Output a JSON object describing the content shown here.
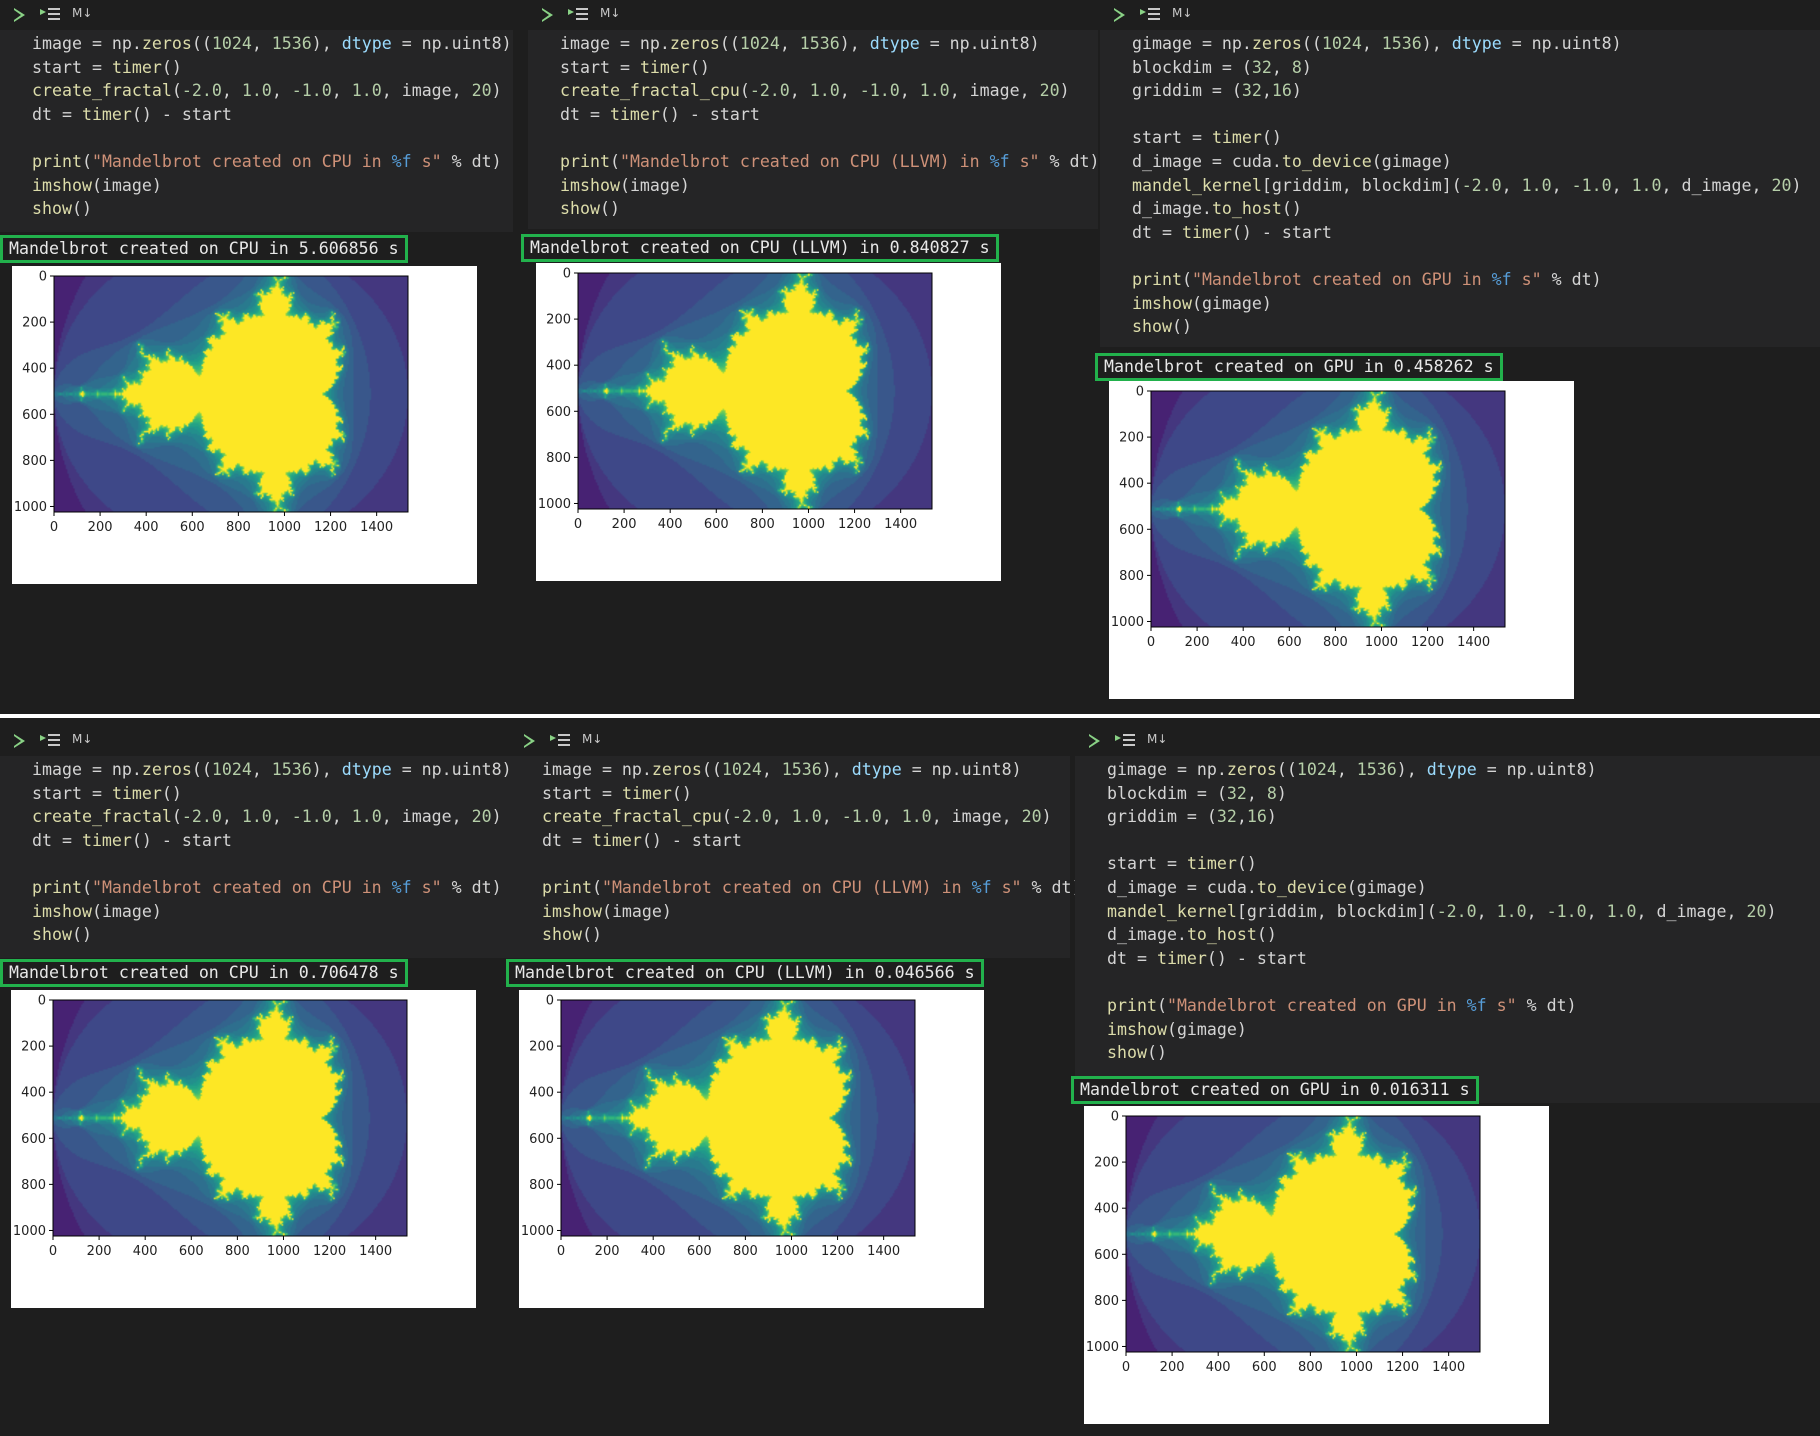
{
  "toolbar": {
    "markdown_label": "M↓"
  },
  "code": {
    "cpu": {
      "l1": [
        "image",
        " = np.",
        "zeros",
        "((",
        "1024",
        ", ",
        "1536",
        "), ",
        "dtype",
        " = np.uint8)"
      ],
      "l2": [
        "start = ",
        "timer",
        "()"
      ],
      "l3": [
        "create_fractal",
        "(",
        "-2.0",
        ", ",
        "1.0",
        ", ",
        "-1.0",
        ", ",
        "1.0",
        ", image, ",
        "20",
        ")"
      ],
      "l4": [
        "dt = ",
        "timer",
        "() - start"
      ],
      "l5": [
        "print",
        "(",
        "\"Mandelbrot created on CPU in ",
        "%f",
        " s\"",
        " % dt)"
      ],
      "l6": [
        "imshow",
        "(image)"
      ],
      "l7": [
        "show",
        "()"
      ]
    },
    "llvm": {
      "l1": [
        "image",
        " = np.",
        "zeros",
        "((",
        "1024",
        ", ",
        "1536",
        "), ",
        "dtype",
        " = np.uint8)"
      ],
      "l2": [
        "start = ",
        "timer",
        "()"
      ],
      "l3": [
        "create_fractal_cpu",
        "(",
        "-2.0",
        ", ",
        "1.0",
        ", ",
        "-1.0",
        ", ",
        "1.0",
        ", image, ",
        "20",
        ")"
      ],
      "l4": [
        "dt = ",
        "timer",
        "() - start"
      ],
      "l5": [
        "print",
        "(",
        "\"Mandelbrot created on CPU (LLVM) in ",
        "%f",
        " s\"",
        " % dt)"
      ],
      "l6": [
        "imshow",
        "(image)"
      ],
      "l7": [
        "show",
        "()"
      ]
    },
    "gpu": {
      "l1": [
        "gimage",
        " = np.",
        "zeros",
        "((",
        "1024",
        ", ",
        "1536",
        "), ",
        "dtype",
        " = np.uint8)"
      ],
      "l2": [
        "blockdim = (",
        "32",
        ", ",
        "8",
        ")"
      ],
      "l3": [
        "griddim = (",
        "32",
        ",",
        "16",
        ")"
      ],
      "l4": [
        "start = ",
        "timer",
        "()"
      ],
      "l5": [
        "d_image = cuda.",
        "to_device",
        "(gimage)"
      ],
      "l6": [
        "mandel_kernel",
        "[griddim, blockdim](",
        "-2.0",
        ", ",
        "1.0",
        ", ",
        "-1.0",
        ", ",
        "1.0",
        ", d_image, ",
        "20",
        ")"
      ],
      "l7": [
        "d_image.",
        "to_host",
        "()"
      ],
      "l8": [
        "dt = ",
        "timer",
        "() - start"
      ],
      "l9": [
        "print",
        "(",
        "\"Mandelbrot created on GPU in ",
        "%f",
        " s\"",
        " % dt)"
      ],
      "l10": [
        "imshow",
        "(gimage)"
      ],
      "l11": [
        "show",
        "()"
      ]
    }
  },
  "outputs": {
    "top_cpu": "Mandelbrot created on CPU in 5.606856 s",
    "top_llvm": "Mandelbrot created on CPU (LLVM) in 0.840827 s",
    "top_gpu": "Mandelbrot created on GPU in 0.458262 s",
    "bottom_cpu": "Mandelbrot created on CPU in 0.706478 s",
    "bottom_llvm": "Mandelbrot created on CPU (LLVM) in 0.046566 s",
    "bottom_gpu": "Mandelbrot created on GPU in 0.016311 s"
  },
  "plot_axes": {
    "x_ticks": [
      "0",
      "200",
      "400",
      "600",
      "800",
      "1000",
      "1200",
      "1400"
    ],
    "y_ticks": [
      "0",
      "200",
      "400",
      "600",
      "800",
      "1000"
    ],
    "x_range": [
      0,
      1536
    ],
    "y_range": [
      0,
      1024
    ]
  },
  "colors": {
    "background": "#1e1e1e",
    "output_border": "#22b14c",
    "viridis_dark": "#440154",
    "viridis_yellow": "#fde725",
    "run_icon": "#89d185"
  }
}
